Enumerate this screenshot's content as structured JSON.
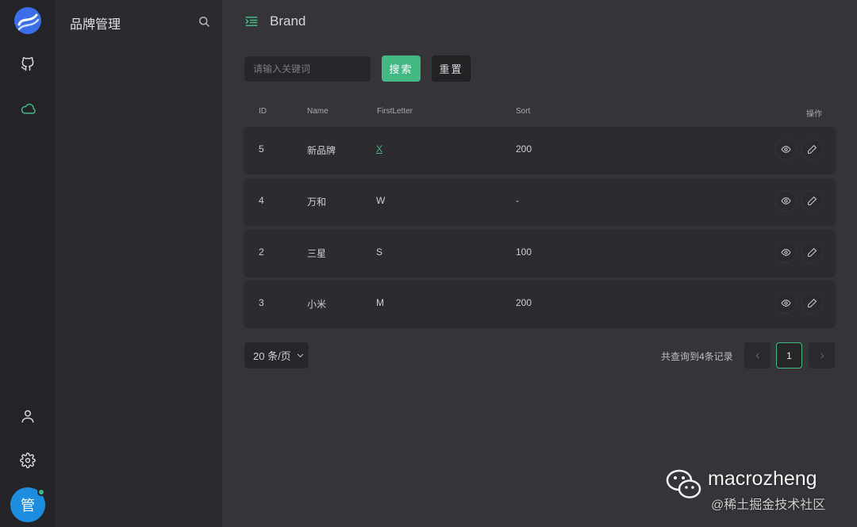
{
  "rail": {
    "logo_icon": "app-logo",
    "top_icons": [
      "github-icon",
      "cloud-icon"
    ],
    "bottom_icons": [
      "user-icon",
      "gear-icon"
    ],
    "avatar_text": "管",
    "avatar_color": "#1d8ddf",
    "online_color": "#42b883"
  },
  "sidebar": {
    "title": "品牌管理"
  },
  "header": {
    "title": "Brand"
  },
  "toolbar": {
    "search_placeholder": "请输入关键词",
    "search_value": "",
    "search_label": "搜索",
    "reset_label": "重置"
  },
  "table": {
    "columns": [
      "ID",
      "Name",
      "FirstLetter",
      "Sort",
      "操作"
    ],
    "rows": [
      {
        "id": "5",
        "name": "新品牌",
        "first_letter": "X",
        "sort": "200"
      },
      {
        "id": "4",
        "name": "万和",
        "first_letter": "W",
        "sort": "-"
      },
      {
        "id": "2",
        "name": "三星",
        "first_letter": "S",
        "sort": "100"
      },
      {
        "id": "3",
        "name": "小米",
        "first_letter": "M",
        "sort": "200"
      }
    ],
    "row_actions": [
      "eye-icon",
      "edit-icon"
    ]
  },
  "pagination": {
    "page_size_label": "20 条/页",
    "total_text": "共查询到4条记录",
    "current_page": "1"
  },
  "watermark": {
    "name": "macrozheng",
    "sub": "@稀土掘金技术社区"
  },
  "colors": {
    "accent": "#42b883",
    "background": "#353539",
    "rail": "#242428",
    "sidebar": "#2b2b2f"
  }
}
